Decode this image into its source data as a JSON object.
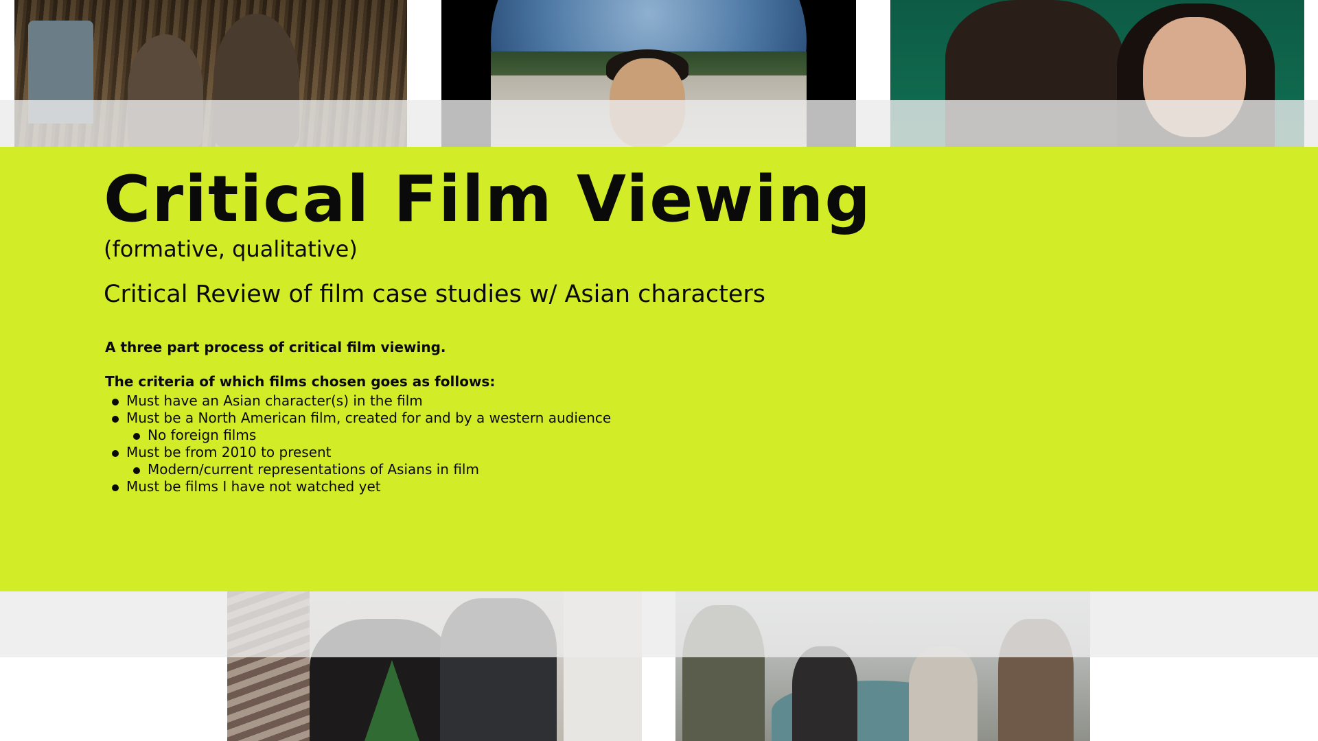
{
  "slide": {
    "title": "Critical Film Viewing",
    "subtitle": "(formative, qualitative)",
    "heading": "Critical Review of film case studies w/ Asian characters",
    "intro": "A three part process of critical film viewing.",
    "criteria_heading": "The criteria of which films chosen goes as follows:",
    "criteria": [
      {
        "level": 1,
        "text": "Must have an Asian character(s) in the film"
      },
      {
        "level": 1,
        "text": "Must be a North American film, created for and by a western audience"
      },
      {
        "level": 2,
        "text": "No foreign films"
      },
      {
        "level": 1,
        "text": "Must be from 2010 to present"
      },
      {
        "level": 2,
        "text": "Modern/current representations of Asians in film"
      },
      {
        "level": 1,
        "text": "Must be films I have not watched yet"
      }
    ]
  },
  "colors": {
    "panel": "#d3ec28",
    "text": "#0a0a0a",
    "band": "#ebebeb",
    "background": "#ffffff"
  }
}
